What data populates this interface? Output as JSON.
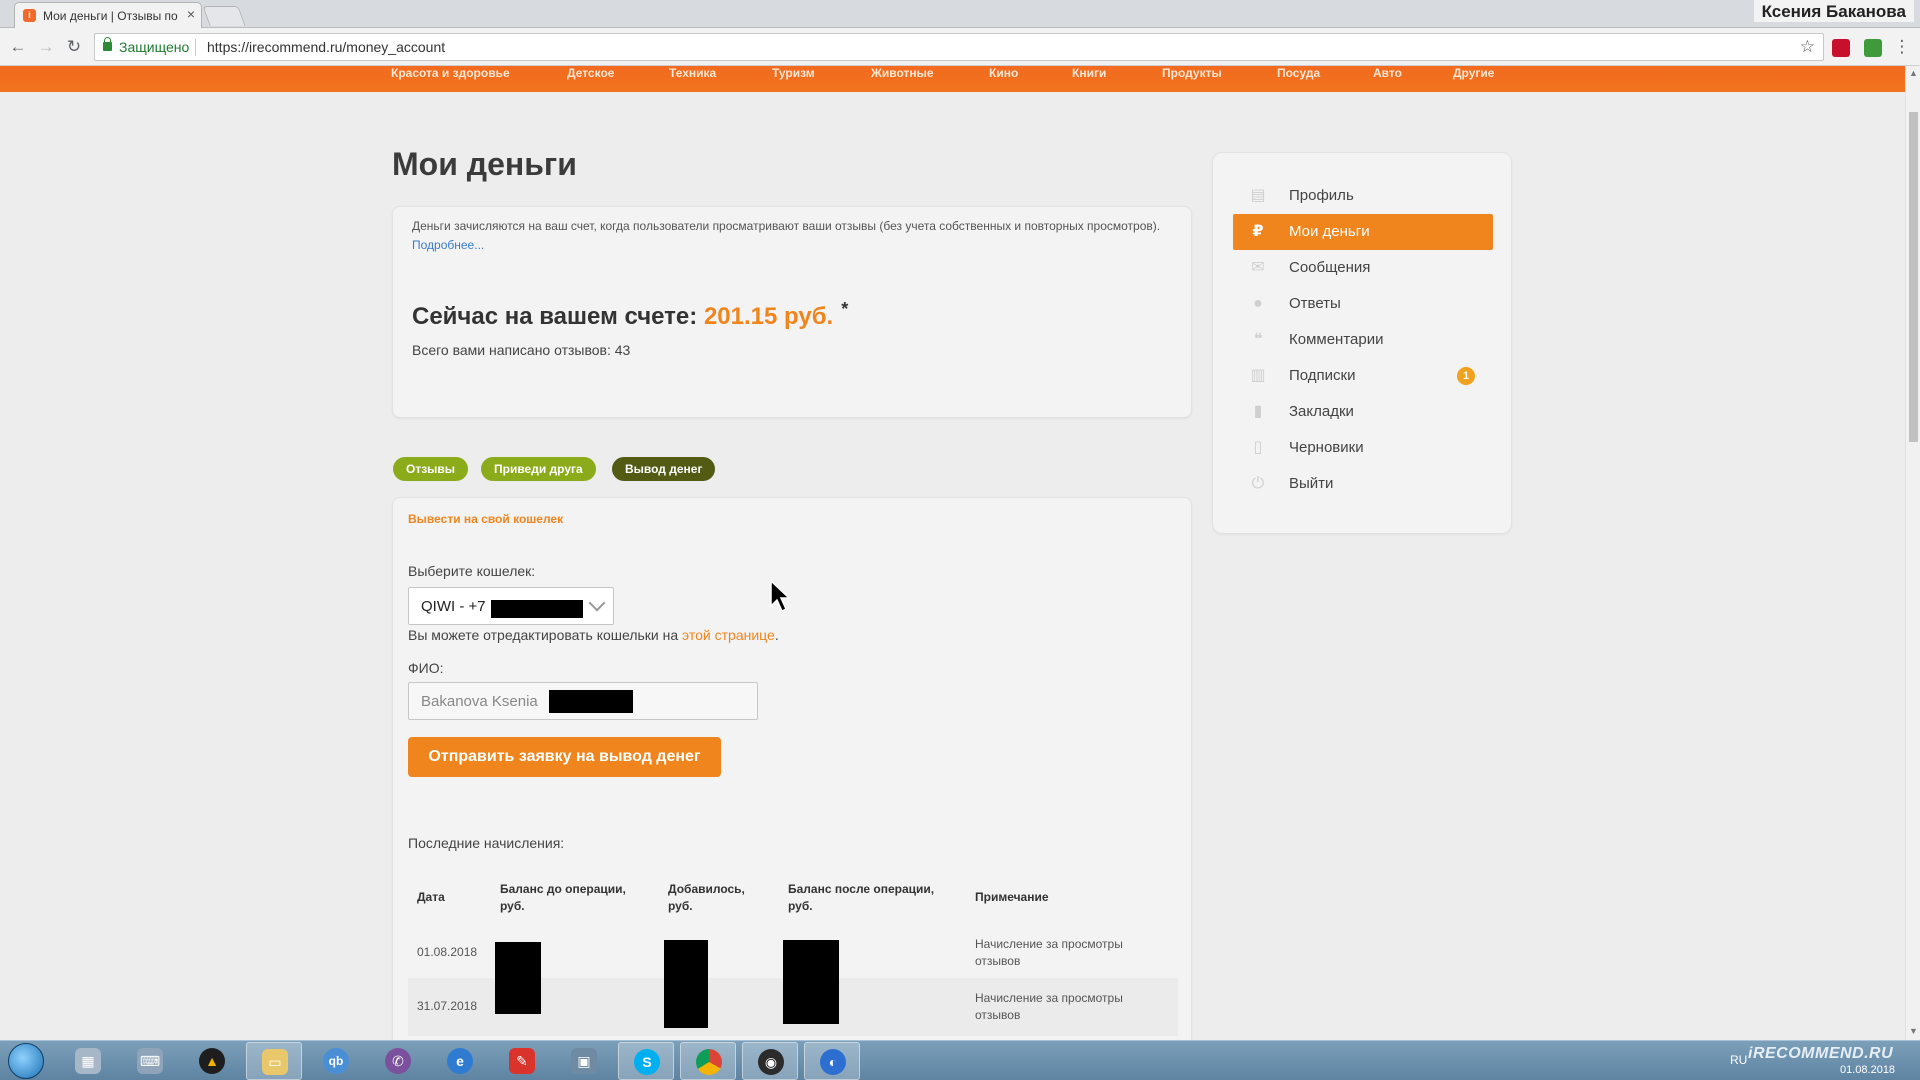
{
  "browser": {
    "tab_title": "Мои деньги | Отзывы по",
    "secure_label": "Защищено",
    "url": "https://irecommend.ru/money_account",
    "user_name": "Ксения Баканова"
  },
  "categories": [
    "Красота и здоровье",
    "Детское",
    "Техника",
    "Туризм",
    "Животные",
    "Кино",
    "Книги",
    "Продукты",
    "Посуда",
    "Авто",
    "Другие"
  ],
  "page": {
    "title": "Мои деньги",
    "info_text": "Деньги зачисляются на ваш счет, когда пользователи просматривают ваши отзывы (без учета собственных и повторных просмотров).",
    "info_link": "Подробнее...",
    "balance_label": "Сейчас на вашем счете:",
    "balance_amount": "201.15 руб.",
    "balance_asterisk": "*",
    "reviews_count": "Всего вами написано отзывов: 43"
  },
  "pills": [
    "Отзывы",
    "Приведи друга",
    "Вывод денег"
  ],
  "withdraw": {
    "section_label": "Вывести на свой кошелек",
    "wallet_label": "Выберите кошелек:",
    "wallet_value": "QIWI - +7",
    "edit_hint": "Вы можете отредактировать кошельки на",
    "edit_link": "этой странице",
    "edit_hint_end": ".",
    "fio_label": "ФИО:",
    "fio_value": "Bakanova Ksenia",
    "submit_label": "Отправить заявку на вывод денег",
    "recent_label": "Последние начисления:"
  },
  "table": {
    "headers": {
      "date": "Дата",
      "before": "Баланс до операции, руб.",
      "added": "Добавилось, руб.",
      "after": "Баланс после операции, руб.",
      "note": "Примечание"
    },
    "rows": [
      {
        "date": "01.08.2018",
        "note": "Начисление за просмотры отзывов"
      },
      {
        "date": "31.07.2018",
        "note": "Начисление за просмотры отзывов"
      }
    ]
  },
  "sidebar": {
    "items": [
      {
        "label": "Профиль",
        "icon": "id-card-icon"
      },
      {
        "label": "Мои деньги",
        "icon": "ruble-icon"
      },
      {
        "label": "Сообщения",
        "icon": "envelope-icon"
      },
      {
        "label": "Ответы",
        "icon": "chat-bubble-icon"
      },
      {
        "label": "Комментарии",
        "icon": "comments-icon"
      },
      {
        "label": "Подписки",
        "icon": "subscriptions-icon",
        "badge": "1"
      },
      {
        "label": "Закладки",
        "icon": "bookmark-icon"
      },
      {
        "label": "Черновики",
        "icon": "draft-file-icon"
      },
      {
        "label": "Выйти",
        "icon": "power-icon"
      }
    ]
  },
  "taskbar": {
    "lang": "RU",
    "watermark": "iRECOMMEND.RU",
    "date": "01.08.2018"
  },
  "colors": {
    "accent": "#f0851e",
    "nav_orange": "#f26a1f",
    "pill_green": "#8bab1b",
    "pill_dark": "#525a13",
    "link_blue": "#3a7bc8"
  }
}
